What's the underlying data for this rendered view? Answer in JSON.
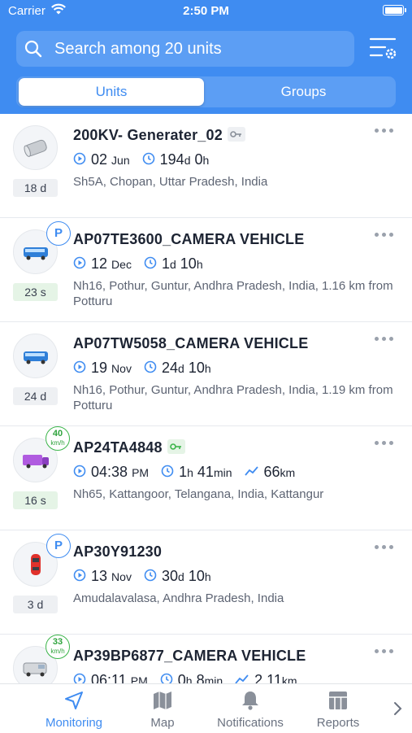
{
  "status_bar": {
    "carrier": "Carrier",
    "time": "2:50 PM"
  },
  "search": {
    "placeholder": "Search among 20 units"
  },
  "tabs": {
    "units": "Units",
    "groups": "Groups"
  },
  "units": [
    {
      "name": "200KV- Generater_02",
      "has_key": true,
      "age": "18 d",
      "date_num": "02",
      "date_unit": "Jun",
      "dur_a": "194",
      "dur_a_unit": "d",
      "dur_b": "0",
      "dur_b_unit": "h",
      "address": "Sh5A, Chopan, Uttar Pradesh, India",
      "icon": "generator-icon"
    },
    {
      "name": "AP07TE3600_CAMERA VEHICLE",
      "badge": "P",
      "age": "23 s",
      "date_num": "12",
      "date_unit": "Dec",
      "dur_a": "1",
      "dur_a_unit": "d",
      "dur_b": "10",
      "dur_b_unit": "h",
      "address": "Nh16, Pothur, Guntur, Andhra Pradesh, India, 1.16 km from Potturu",
      "icon": "bus-icon"
    },
    {
      "name": "AP07TW5058_CAMERA VEHICLE",
      "age": "24 d",
      "date_num": "19",
      "date_unit": "Nov",
      "dur_a": "24",
      "dur_a_unit": "d",
      "dur_b": "10",
      "dur_b_unit": "h",
      "address": "Nh16, Pothur, Guntur, Andhra Pradesh, India, 1.19 km from Potturu",
      "icon": "bus-icon"
    },
    {
      "name": "AP24TA4848",
      "has_key": true,
      "speed": "40",
      "speed_unit": "km/h",
      "age": "16 s",
      "date_num": "04:38",
      "date_unit": "PM",
      "dur_a": "1",
      "dur_a_unit": "h",
      "dur_b": "41",
      "dur_b_unit": "min",
      "mileage": "66",
      "mileage_unit": "km",
      "address": "Nh65, Kattangoor, Telangana, India, Kattangur",
      "icon": "truck-icon"
    },
    {
      "name": "AP30Y91230",
      "badge": "P",
      "age": "3 d",
      "date_num": "13",
      "date_unit": "Nov",
      "dur_a": "30",
      "dur_a_unit": "d",
      "dur_b": "10",
      "dur_b_unit": "h",
      "address": "Amudalavalasa, Andhra Pradesh, India",
      "icon": "car-icon"
    },
    {
      "name": "AP39BP6877_CAMERA VEHICLE",
      "speed": "33",
      "speed_unit": "km/h",
      "date_num": "06:11",
      "date_unit": "PM",
      "dur_a": "0",
      "dur_a_unit": "h",
      "dur_b": "8",
      "dur_b_unit": "min",
      "mileage": "2.11",
      "mileage_unit": "km",
      "icon": "van-icon"
    }
  ],
  "tabbar": {
    "monitoring": "Monitoring",
    "map": "Map",
    "notifications": "Notifications",
    "reports": "Reports"
  },
  "colors": {
    "accent": "#3f8cf1",
    "moving": "#3bb54a"
  }
}
